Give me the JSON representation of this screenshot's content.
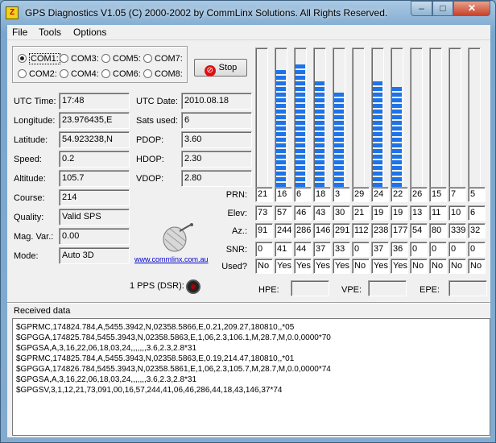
{
  "window": {
    "title": "GPS Diagnostics V1.05 (C) 2000-2002 by CommLinx Solutions. All Rights Reserved.",
    "min": "–",
    "max": "□",
    "close": "✕"
  },
  "menu": [
    "File",
    "Tools",
    "Options"
  ],
  "ports": [
    {
      "label": "COM1:",
      "selected": true
    },
    {
      "label": "COM3:",
      "selected": false
    },
    {
      "label": "COM5:",
      "selected": false
    },
    {
      "label": "COM7:",
      "selected": false
    },
    {
      "label": "COM2:",
      "selected": false
    },
    {
      "label": "COM4:",
      "selected": false
    },
    {
      "label": "COM6:",
      "selected": false
    },
    {
      "label": "COM8:",
      "selected": false
    }
  ],
  "stop_label": "Stop",
  "left_fields": [
    {
      "label": "UTC Time:",
      "value": "17:48"
    },
    {
      "label": "Longitude:",
      "value": "23.976435,E"
    },
    {
      "label": "Latitude:",
      "value": "54.923238,N"
    },
    {
      "label": "Speed:",
      "value": "0.2"
    },
    {
      "label": "Altitude:",
      "value": "105.7"
    },
    {
      "label": "Course:",
      "value": "214"
    },
    {
      "label": "Quality:",
      "value": "Valid SPS"
    },
    {
      "label": "Mag. Var.:",
      "value": "0.00"
    },
    {
      "label": "Mode:",
      "value": "Auto 3D"
    }
  ],
  "right_fields": [
    {
      "label": "UTC Date:",
      "value": "2010.08.18"
    },
    {
      "label": "Sats used:",
      "value": "6"
    },
    {
      "label": "PDOP:",
      "value": "3.60"
    },
    {
      "label": "HDOP:",
      "value": "2.30"
    },
    {
      "label": "VDOP:",
      "value": "2.80"
    }
  ],
  "website": "www.commlinx.com.au",
  "pps_label": "1 PPS (DSR):",
  "sat_row_labels": [
    "PRN:",
    "Elev:",
    "Az.:",
    "SNR:",
    "Used?"
  ],
  "satellites": [
    {
      "prn": "21",
      "elev": "73",
      "az": "91",
      "snr": "0",
      "used": "No"
    },
    {
      "prn": "16",
      "elev": "57",
      "az": "244",
      "snr": "41",
      "used": "Yes"
    },
    {
      "prn": "6",
      "elev": "46",
      "az": "286",
      "snr": "44",
      "used": "Yes"
    },
    {
      "prn": "18",
      "elev": "43",
      "az": "146",
      "snr": "37",
      "used": "Yes"
    },
    {
      "prn": "3",
      "elev": "30",
      "az": "291",
      "snr": "33",
      "used": "Yes"
    },
    {
      "prn": "29",
      "elev": "21",
      "az": "112",
      "snr": "0",
      "used": "No"
    },
    {
      "prn": "24",
      "elev": "19",
      "az": "238",
      "snr": "37",
      "used": "Yes"
    },
    {
      "prn": "22",
      "elev": "19",
      "az": "177",
      "snr": "36",
      "used": "Yes"
    },
    {
      "prn": "26",
      "elev": "13",
      "az": "54",
      "snr": "0",
      "used": "No"
    },
    {
      "prn": "15",
      "elev": "11",
      "az": "80",
      "snr": "0",
      "used": "No"
    },
    {
      "prn": "7",
      "elev": "10",
      "az": "339",
      "snr": "0",
      "used": "No"
    },
    {
      "prn": "5",
      "elev": "6",
      "az": "32",
      "snr": "0",
      "used": "No"
    }
  ],
  "hpe_label": "HPE:",
  "vpe_label": "VPE:",
  "epe_label": "EPE:",
  "received_label": "Received data",
  "received_lines": [
    "$GPRMC,174824.784,A,5455.3942,N,02358.5866,E,0.21,209.27,180810,,*05",
    "$GPGGA,174825.784,5455.3943,N,02358.5863,E,1,06,2.3,106.1,M,28.7,M,0.0,0000*70",
    "$GPGSA,A,3,16,22,06,18,03,24,,,,,,,3.6,2.3,2.8*31",
    "$GPRMC,174825.784,A,5455.3943,N,02358.5863,E,0.19,214.47,180810,,*01",
    "$GPGGA,174826.784,5455.3943,N,02358.5861,E,1,06,2.3,105.7,M,28.7,M,0.0,0000*74",
    "$GPGSA,A,3,16,22,06,18,03,24,,,,,,,3.6,2.3,2.8*31",
    "$GPGSV,3,1,12,21,73,091,00,16,57,244,41,06,46,286,44,18,43,146,37*74"
  ]
}
